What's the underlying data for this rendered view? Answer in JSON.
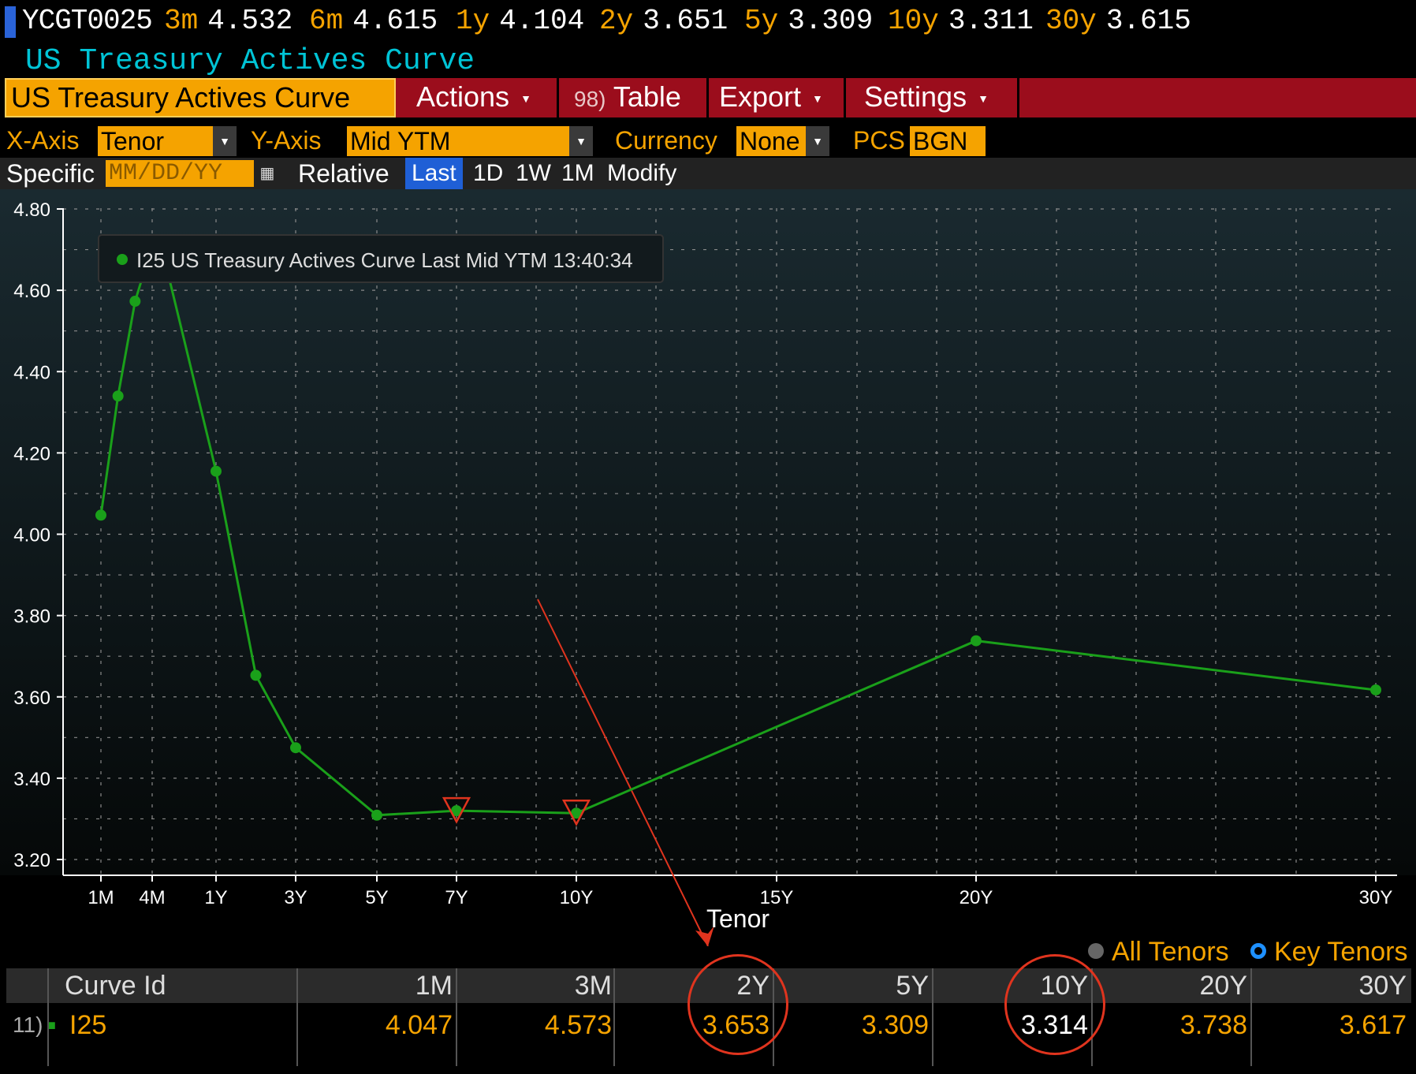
{
  "ticker": {
    "symbol": "YCGT0025",
    "quotes": [
      {
        "tenor": "3m",
        "value": "4.532"
      },
      {
        "tenor": "6m",
        "value": "4.615"
      },
      {
        "tenor": "1y",
        "value": "4.104"
      },
      {
        "tenor": "2y",
        "value": "3.651"
      },
      {
        "tenor": "5y",
        "value": "3.309"
      },
      {
        "tenor": "10y",
        "value": "3.311"
      },
      {
        "tenor": "30y",
        "value": "3.615"
      }
    ]
  },
  "subtitle": "US Treasury Actives Curve",
  "menu": {
    "active": "US Treasury Actives Curve",
    "actions": "Actions",
    "table_num": "98)",
    "table": "Table",
    "export": "Export",
    "settings": "Settings",
    "caret": "▼"
  },
  "axis_row": {
    "x_label": "X-Axis",
    "x_value": "Tenor",
    "y_label": "Y-Axis",
    "y_value": "Mid YTM",
    "currency_label": "Currency",
    "currency_value": "None",
    "pcs_label": "PCS",
    "pcs_value": "BGN"
  },
  "spec_row": {
    "specific_label": "Specific",
    "date_placeholder": "MM/DD/YY",
    "relative_label": "Relative",
    "buttons": [
      "Last",
      "1D",
      "1W",
      "1M",
      "Modify"
    ],
    "selected": "Last"
  },
  "chart_data": {
    "type": "line",
    "legend": "I25 US Treasury Actives Curve Last Mid YTM 13:40:34",
    "xlabel": "Tenor",
    "ylabel": "",
    "ylim": [
      3.2,
      4.8
    ],
    "yticks": [
      "3.20",
      "3.40",
      "3.60",
      "3.80",
      "4.00",
      "4.20",
      "4.40",
      "4.60",
      "4.80"
    ],
    "xticks": [
      {
        "label": "1M",
        "years": 0.0833
      },
      {
        "label": "4M",
        "years": 0.3333
      },
      {
        "label": "1Y",
        "years": 1
      },
      {
        "label": "3Y",
        "years": 3
      },
      {
        "label": "5Y",
        "years": 5
      },
      {
        "label": "7Y",
        "years": 7
      },
      {
        "label": "10Y",
        "years": 10
      },
      {
        "label": "15Y",
        "years": 15
      },
      {
        "label": "20Y",
        "years": 20
      },
      {
        "label": "30Y",
        "years": 30
      }
    ],
    "series": [
      {
        "name": "I25",
        "color": "#1aa01a",
        "points": [
          {
            "years": 0.0833,
            "y": 4.047
          },
          {
            "years": 0.1667,
            "y": 4.34
          },
          {
            "years": 0.25,
            "y": 4.573
          },
          {
            "years": 0.3333,
            "y": 4.71
          },
          {
            "years": 0.5,
            "y": 4.64
          },
          {
            "years": 1,
            "y": 4.155
          },
          {
            "years": 2,
            "y": 3.653
          },
          {
            "years": 3,
            "y": 3.475
          },
          {
            "years": 5,
            "y": 3.309
          },
          {
            "years": 7,
            "y": 3.32
          },
          {
            "years": 10,
            "y": 3.314
          },
          {
            "years": 20,
            "y": 3.738
          },
          {
            "years": 30,
            "y": 3.617
          }
        ]
      }
    ],
    "markers": [
      {
        "years": 7,
        "y": 3.32,
        "shape": "triangle-down",
        "color": "#e0341e"
      },
      {
        "years": 10,
        "y": 3.314,
        "shape": "triangle-down",
        "color": "#e0341e"
      }
    ]
  },
  "toggles": {
    "all": "All Tenors",
    "key": "Key Tenors",
    "all_color": "#666666",
    "key_color": "#1e90ff"
  },
  "table": {
    "headers": [
      "Curve Id",
      "1M",
      "3M",
      "2Y",
      "5Y",
      "10Y",
      "20Y",
      "30Y"
    ],
    "row": {
      "num": "11)",
      "id": "I25",
      "values": [
        "4.047",
        "4.573",
        "3.653",
        "3.309",
        "3.314",
        "3.738",
        "3.617"
      ]
    }
  },
  "colors": {
    "accent": "#f5a300",
    "menubar": "#9b0d1c",
    "subtitle": "#00c4d6",
    "series": "#1aa01a",
    "annotation": "#e0341e"
  }
}
